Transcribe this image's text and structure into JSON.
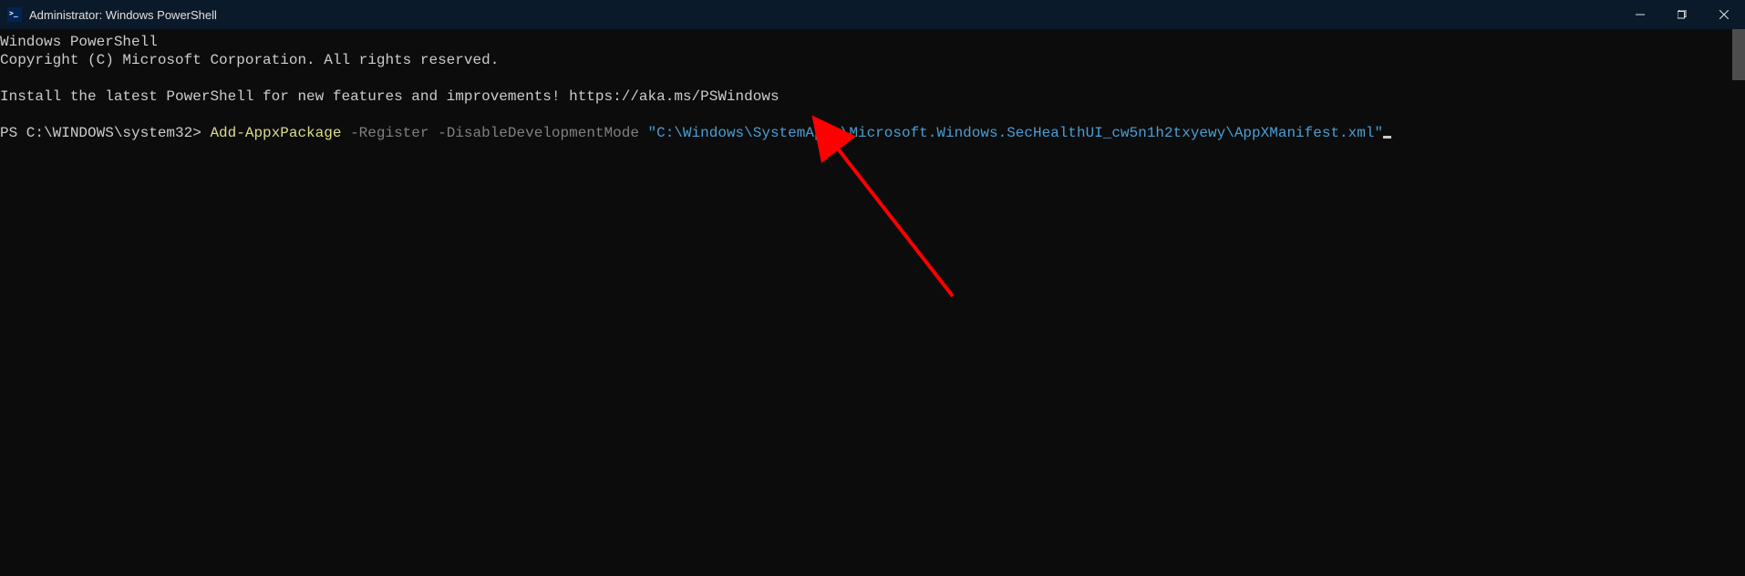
{
  "window": {
    "title": "Administrator: Windows PowerShell"
  },
  "terminal": {
    "line1": "Windows PowerShell",
    "line2": "Copyright (C) Microsoft Corporation. All rights reserved.",
    "line3": "",
    "line4": "Install the latest PowerShell for new features and improvements! https://aka.ms/PSWindows",
    "line5": "",
    "prompt": "PS C:\\WINDOWS\\system32> ",
    "cmdlet": "Add-AppxPackage",
    "param1": " -Register",
    "param2": " -DisableDevelopmentMode",
    "string": " \"C:\\Windows\\SystemApps\\Microsoft.Windows.SecHealthUI_cw5n1h2txyewy\\AppXManifest.xml\""
  }
}
